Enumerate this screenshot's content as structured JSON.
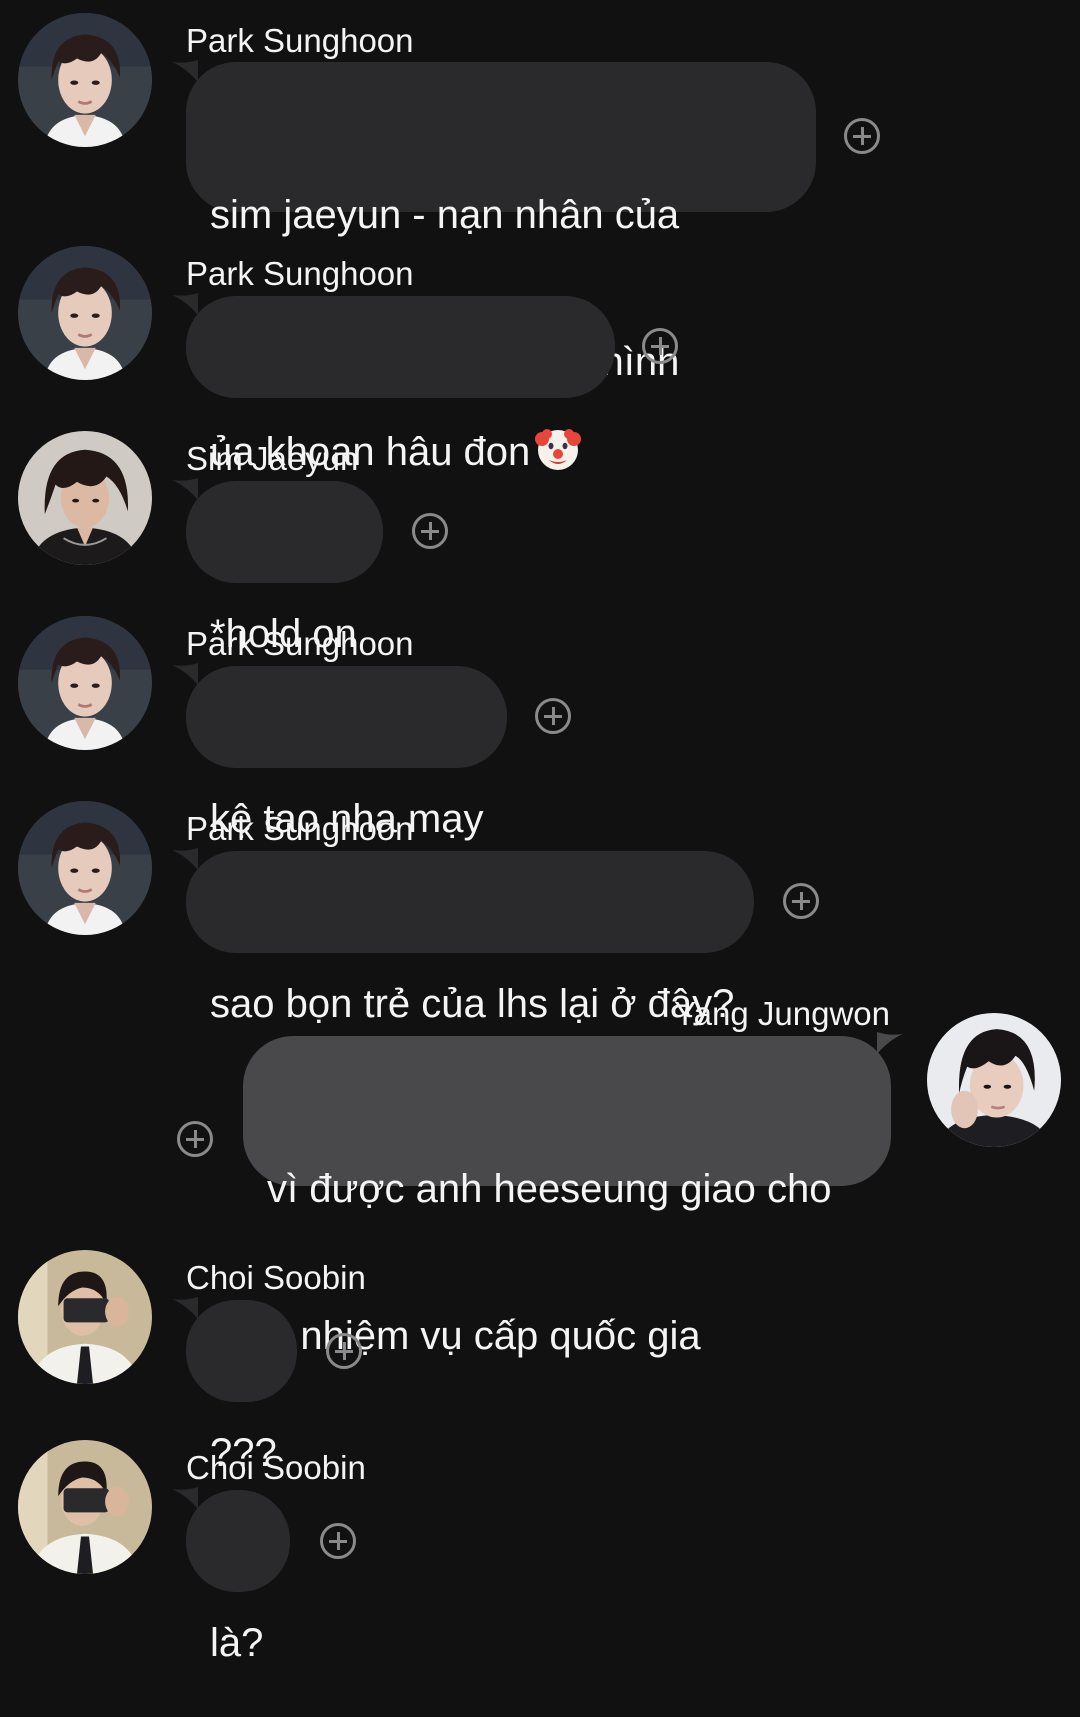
{
  "messages": [
    {
      "sender": "Park Sunghoon",
      "direction": "incoming",
      "avatar": "park-sunghoon-avatar",
      "lines": [
        "sim jaeyun - nạn nhân của",
        "những pha cap màng hình"
      ]
    },
    {
      "sender": "Park Sunghoon",
      "direction": "incoming",
      "avatar": "park-sunghoon-avatar",
      "lines": [
        "ủa khoan hâu đon"
      ],
      "emoji": "clown-face-emoji"
    },
    {
      "sender": "Sim Jaeyun",
      "direction": "incoming",
      "avatar": "sim-jaeyun-avatar",
      "lines": [
        "*hold on"
      ]
    },
    {
      "sender": "Park Sunghoon",
      "direction": "incoming",
      "avatar": "park-sunghoon-avatar",
      "lines": [
        "kệ tao nha mạy"
      ]
    },
    {
      "sender": "Park Sunghoon",
      "direction": "incoming",
      "avatar": "park-sunghoon-avatar",
      "lines": [
        "sao bọn trẻ của lhs lại ở đây?"
      ]
    },
    {
      "sender": "Yang Jungwon",
      "direction": "outgoing",
      "avatar": "yang-jungwon-avatar",
      "lines": [
        "vì được anh heeseung giao cho",
        "1 nhiệm vụ cấp quốc gia"
      ]
    },
    {
      "sender": "Choi Soobin",
      "direction": "incoming",
      "avatar": "choi-soobin-avatar",
      "lines": [
        "???"
      ]
    },
    {
      "sender": "Choi Soobin",
      "direction": "incoming",
      "avatar": "choi-soobin-avatar",
      "lines": [
        "là?"
      ]
    }
  ],
  "icons": {
    "reaction": "add-reaction-icon"
  },
  "colors": {
    "background": "#111112",
    "incoming_bubble": "#2a2a2c",
    "outgoing_bubble": "#49494b",
    "text": "#f4f4f4",
    "reaction_icon": "#8a8a8c"
  }
}
